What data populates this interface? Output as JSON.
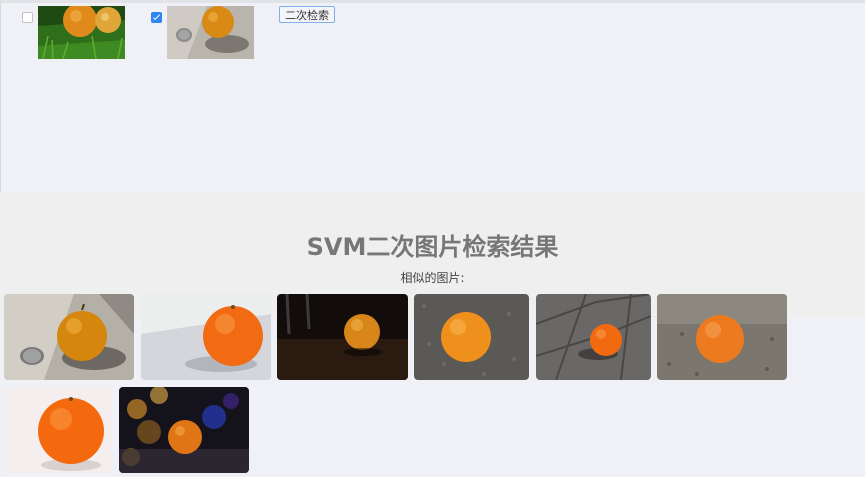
{
  "query_panel": {
    "items": [
      {
        "checked": false,
        "image": "oranges-on-grass"
      },
      {
        "checked": true,
        "image": "orange-with-coin"
      }
    ],
    "recheck_button": "二次检索"
  },
  "results": {
    "title": "SVM二次图片检索结果",
    "subtitle": "相似的图片:",
    "images": [
      "orange-with-coin-on-stone",
      "orange-on-white-table",
      "orange-on-dark-wood",
      "orange-on-asphalt",
      "orange-on-paving-tiles",
      "orange-on-gravel",
      "orange-on-white",
      "orange-with-bokeh-lights"
    ]
  },
  "colors": {
    "orange": "#f07a1a",
    "check_accent": "#2f87f1"
  }
}
